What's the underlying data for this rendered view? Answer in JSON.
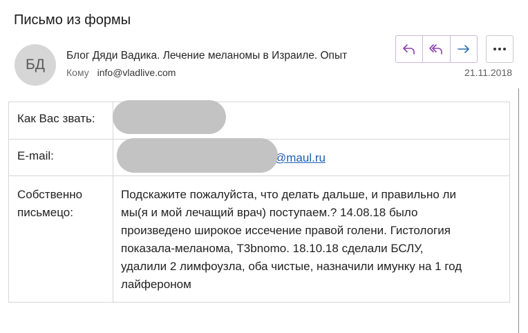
{
  "message": {
    "subject": "Письмо из формы",
    "avatar_initials": "БД",
    "sender": "Блог Дяди Вадика. Лечение меланомы в Израиле. Опыт",
    "to_label": "Кому",
    "to_address": "info@vladlive.com",
    "date": "21.11.2018"
  },
  "actions": {
    "reply": "reply-icon",
    "reply_all": "reply-all-icon",
    "forward": "forward-icon",
    "more": "more-icon",
    "accent_color": "#8a3fb0"
  },
  "form": {
    "name_label": "Как Вас звать:",
    "email_label": "E-mail:",
    "email_domain": "@maul.ru",
    "message_label_line1": "Собственно",
    "message_label_line2": "письмецо:",
    "message_lines": [
      "Подскажите пожалуйста, что делать дальше, и правильно ли",
      "мы(я и мой лечащий врач) поступаем.? 14.08.18 было",
      "произведено широкое иссечение правой голени. Гистология",
      "показала-меланома, T3bnomo. 18.10.18 сделали БСЛУ,",
      "удалили 2 лимфоузла, оба чистые, назначили имунку на 1 год",
      "лайфероном"
    ]
  }
}
